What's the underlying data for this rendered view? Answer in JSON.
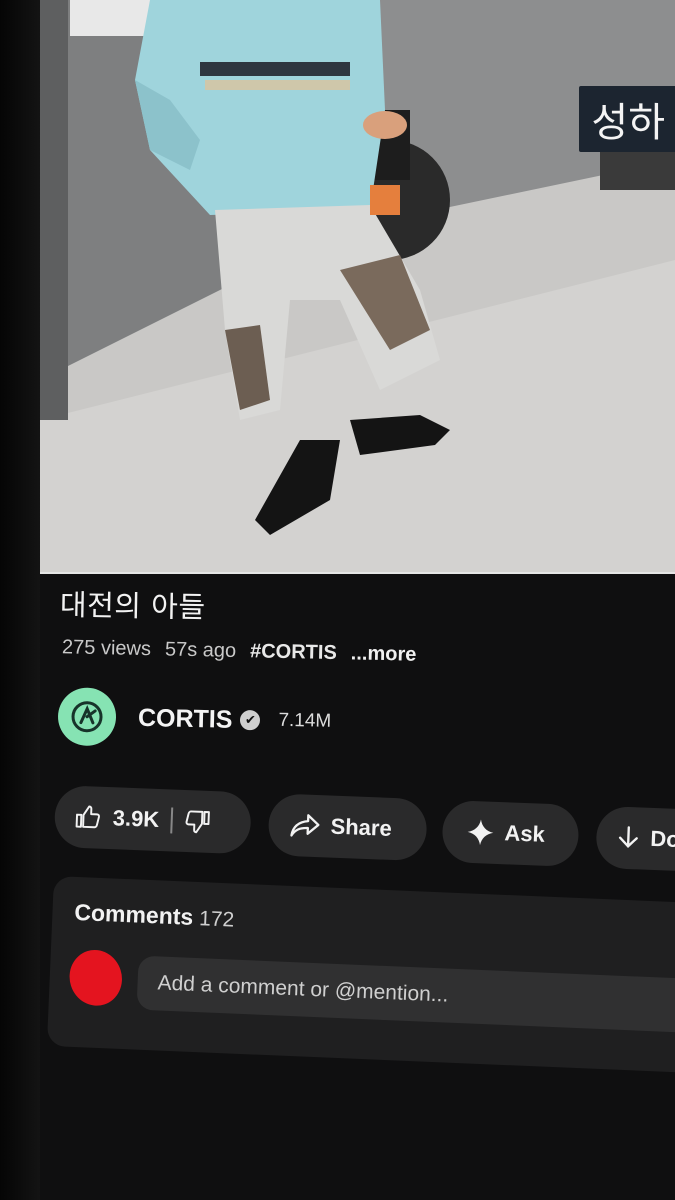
{
  "video": {
    "overlay_text": "성하",
    "title": "대전의 아들",
    "views": "275 views",
    "age": "57s ago",
    "hashtag": "#CORTIS",
    "more_label": "...more"
  },
  "channel": {
    "name": "CORTIS",
    "subscribers": "7.14M",
    "verified": true,
    "logo_color": "#86e3b3"
  },
  "actions": {
    "likes": "3.9K",
    "share_label": "Share",
    "ask_label": "Ask",
    "download_label": "Do"
  },
  "comments": {
    "heading": "Comments",
    "count": "172",
    "input_placeholder": "Add a comment or @mention..."
  },
  "colors": {
    "background": "#0f0f10",
    "pill": "#2a2a2b",
    "panel": "#1f1f20",
    "avatar_redaction": "#e4141f"
  },
  "icons": [
    "thumbs-up-icon",
    "thumbs-down-icon",
    "share-arrow-icon",
    "sparkle-icon",
    "download-arrow-icon",
    "verified-check-icon"
  ]
}
